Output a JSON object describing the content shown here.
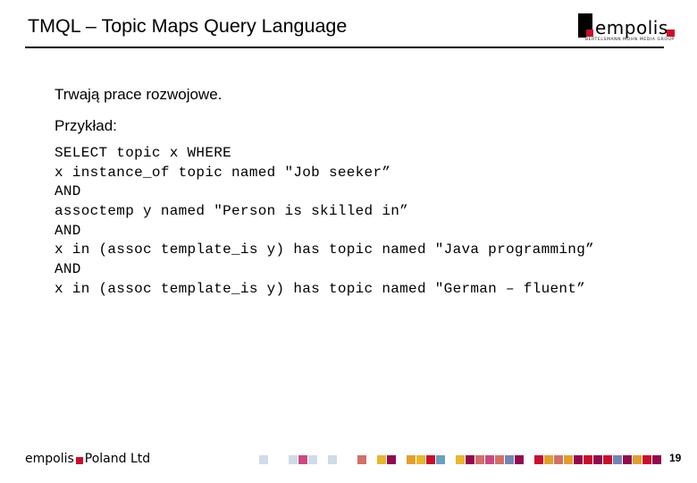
{
  "slide": {
    "title": "TMQL – Topic Maps Query Language",
    "page_number": "19"
  },
  "logo": {
    "wordmark": "empolis",
    "tagline": "Bertelsmann Mohn Media Group"
  },
  "body": {
    "lead_1": "Trwają prace rozwojowe.",
    "lead_2": "Przykład:",
    "code_lines": [
      "SELECT topic x WHERE",
      "x instance_of topic named \"Job seeker”",
      "AND",
      "assoctemp y named \"Person is skilled in”",
      "AND",
      "x in (assoc template_is y) has topic named \"Java programming”",
      "AND",
      "x in (assoc template_is y) has topic named \"German – fluent”"
    ]
  },
  "footer": {
    "brand_left": "empolis",
    "brand_right": "Poland Ltd",
    "decor_squares": [
      "#cfdbe8",
      null,
      null,
      "#cfdbe8",
      "#c94a82",
      "#cfdbe8",
      null,
      "#cfdbe8",
      null,
      null,
      "#d0706a",
      null,
      "#e6b830",
      "#900b50",
      null,
      "#e0a030",
      "#e6b830",
      "#c8102e",
      "#6aa0bd",
      null,
      "#e6b830",
      "#900b50",
      "#d0706a",
      "#c94a82",
      "#d0706a",
      "#7585b0",
      "#900b50",
      null,
      "#c8102e",
      "#e0a030",
      "#d0706a",
      "#e0a030",
      "#900b50",
      "#c8102e",
      "#900b50",
      "#c8102e",
      "#7585b0",
      "#900b50",
      "#e0a030",
      "#c8102e",
      "#900b50"
    ]
  },
  "colors": {
    "brand_red": "#c8102e"
  }
}
